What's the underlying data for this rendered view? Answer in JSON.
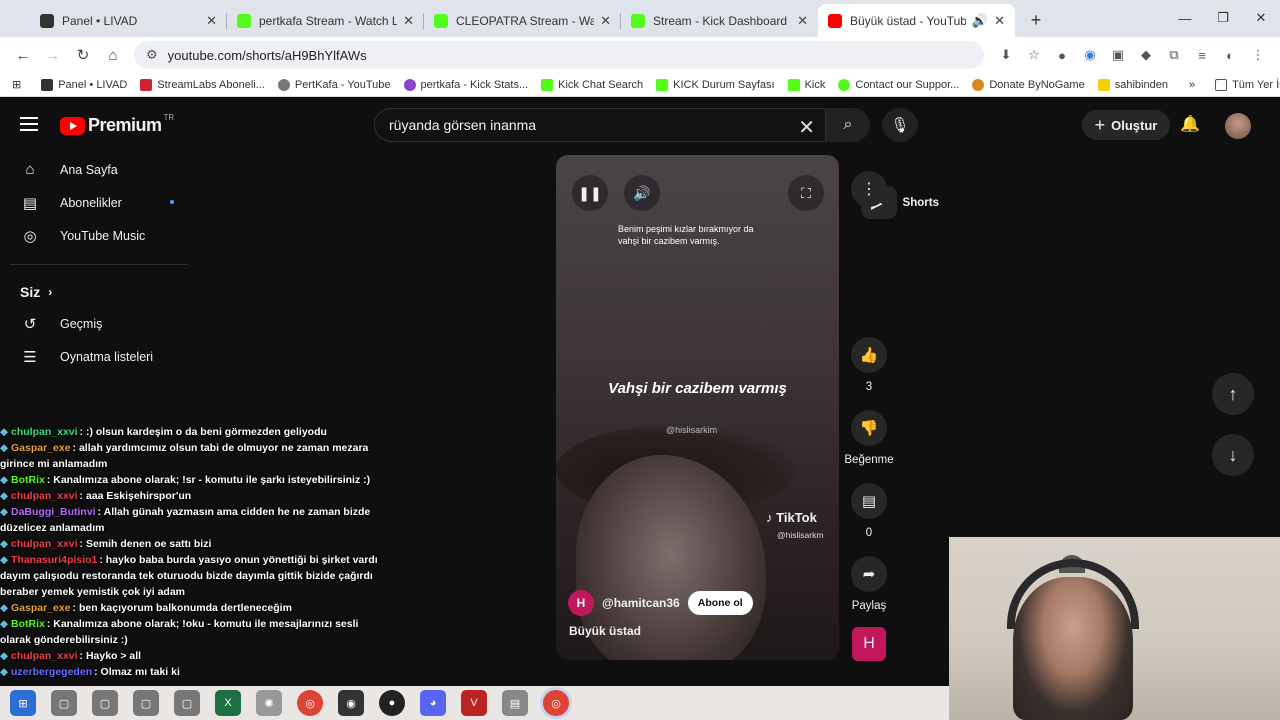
{
  "browser": {
    "tabs": [
      {
        "title": "Panel • LIVAD",
        "color": "#333333"
      },
      {
        "title": "pertkafa Stream - Watch Live on",
        "color": "#53fc18"
      },
      {
        "title": "CLEOPATRA Stream - Watch Live",
        "color": "#53fc18"
      },
      {
        "title": "Stream - Kick Dashboard",
        "color": "#53fc18"
      },
      {
        "title": "Büyük üstad - YouTube",
        "color": "#ff0000"
      }
    ],
    "url": "youtube.com/shorts/aH9BhYlfAWs",
    "bookmarks": [
      {
        "label": "Panel • LIVAD",
        "color": "#333333"
      },
      {
        "label": "StreamLabs Aboneli...",
        "color": "#cc2233"
      },
      {
        "label": "PertKafa - YouTube",
        "color": "#777777"
      },
      {
        "label": "pertkafa - Kick Stats...",
        "color": "#8844cc"
      },
      {
        "label": "Kick Chat Search",
        "color": "#53fc18"
      },
      {
        "label": "KICK Durum Sayfası",
        "color": "#53fc18"
      },
      {
        "label": "Kick",
        "color": "#53fc18"
      },
      {
        "label": "Contact our Suppor...",
        "color": "#53fc18"
      },
      {
        "label": "Donate ByNoGame",
        "color": "#d48a1e"
      },
      {
        "label": "sahibinden",
        "color": "#f2d100"
      }
    ],
    "all_bookmarks": "Tüm Yer İşaretleri"
  },
  "yt": {
    "logo": "Premium",
    "logo_region": "TR",
    "search_value": "rüyanda görsen inanma",
    "create_label": "Oluştur",
    "sidebar": {
      "main": [
        "Ana Sayfa",
        "Shorts",
        "Abonelikler",
        "YouTube Music"
      ],
      "you_header": "Siz",
      "you": [
        "Geçmiş",
        "Oynatma listeleri"
      ]
    }
  },
  "short": {
    "caption_top_1": "Benim peşimi kızlar bırakmıyor da",
    "caption_top_2": "vahşi bir cazibem varmış.",
    "caption_big": "Vahşi bir cazibem varmış",
    "watermark": "@hislisarkim",
    "tiktok_brand": "TikTok",
    "tiktok_handle": "@hislisarkm",
    "channel_initial": "H",
    "channel": "@hamitcan36",
    "subscribe": "Abone ol",
    "title": "Büyük üstad",
    "likes": "3",
    "dislike_label": "Beğenme",
    "comments": "0",
    "share_label": "Paylaş"
  },
  "chat": [
    {
      "user": "chulpan_xxvi",
      "color": "#3ddc84",
      "msg": ": :) olsun kardeşim o da beni görmezden geliyodu"
    },
    {
      "user": "Gaspar_exe",
      "color": "#e3a23b",
      "msg": ": allah yardımcımız olsun tabi de olmuyor ne zaman mezara"
    },
    {
      "user": "",
      "color": "#ffffff",
      "msg": "girince mi anlamadım"
    },
    {
      "user": "BotRix",
      "color": "#53fc18",
      "msg": ": Kanalımıza abone olarak; !sr - komutu ile şarkı isteyebilirsiniz :)"
    },
    {
      "user": "chulpan_xxvi",
      "color": "#e8414d",
      "msg": ": aaa Eskişehirspor'un"
    },
    {
      "user": "DaBuggi_Butinvi",
      "color": "#b36bff",
      "msg": ": Allah günah yazmasın ama cidden he ne zaman bizde"
    },
    {
      "user": "",
      "color": "#ffffff",
      "msg": "düzelicez anlamadım"
    },
    {
      "user": "chulpan_xxvi",
      "color": "#e8414d",
      "msg": ": Semih denen oe sattı bizi"
    },
    {
      "user": "Thanasuri4pisio1",
      "color": "#e8414d",
      "msg": ": hayko baba burda yasıyo onun yönettiği bi şirket vardı"
    },
    {
      "user": "",
      "color": "#ffffff",
      "msg": "dayım çalışıodu restoranda tek oturuodu bizde dayımla gittik bizide çağırdı"
    },
    {
      "user": "",
      "color": "#ffffff",
      "msg": "beraber yemek yemistik çok iyi adam"
    },
    {
      "user": "Gaspar_exe",
      "color": "#e3a23b",
      "msg": ": ben kaçıyorum balkonumda dertleneceğim"
    },
    {
      "user": "BotRix",
      "color": "#53fc18",
      "msg": ": Kanalımıza abone olarak; !oku - komutu ile mesajlarınızı sesli"
    },
    {
      "user": "",
      "color": "#ffffff",
      "msg": "olarak gönderebilirsiniz :)"
    },
    {
      "user": "chulpan_xxvi",
      "color": "#e8414d",
      "msg": ": Hayko > all"
    },
    {
      "user": "uzerbergegeden",
      "color": "#6b6bff",
      "msg": ": Olmaz mı taki ki"
    }
  ]
}
